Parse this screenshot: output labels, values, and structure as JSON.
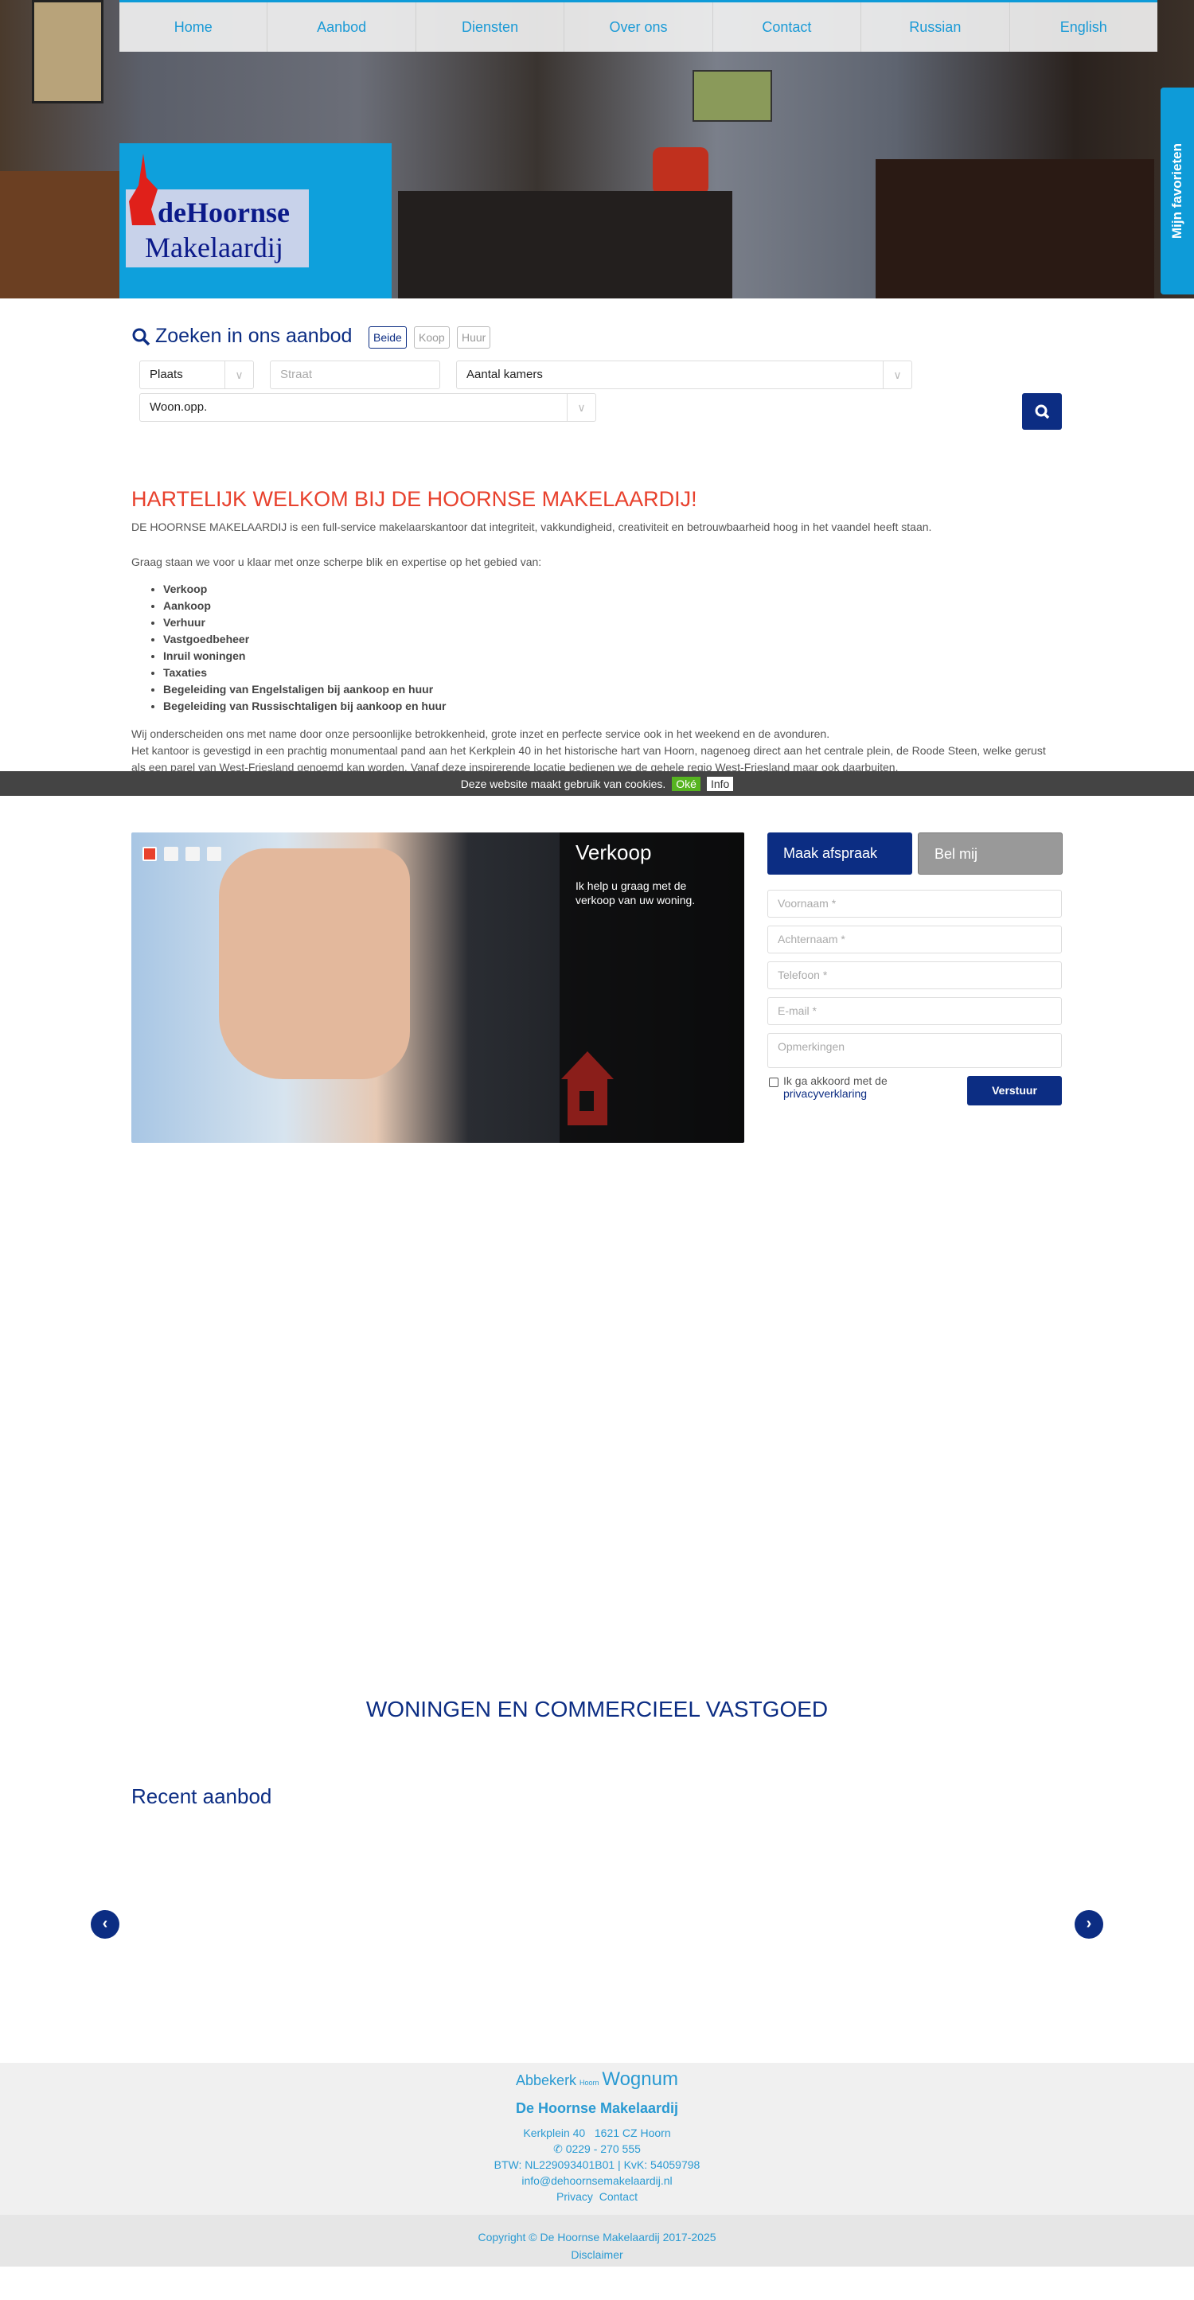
{
  "nav": {
    "items": [
      "Home",
      "Aanbod",
      "Diensten",
      "Over ons",
      "Contact",
      "Russian",
      "English"
    ]
  },
  "logo": {
    "text_top": "deHoornse",
    "text_bottom": "Makelaardij"
  },
  "favorites_tab": "Mijn favorieten",
  "search": {
    "title": "Zoeken in ons aanbod",
    "toggles": [
      "Beide",
      "Koop",
      "Huur"
    ],
    "active_toggle": "Beide",
    "plaats": "Plaats",
    "straat_placeholder": "Straat",
    "kamers": "Aantal kamers",
    "woonopp": "Woon.opp."
  },
  "welcome": {
    "title": "HARTELIJK WELKOM BIJ DE HOORNSE MAKELAARDIJ!",
    "intro": "DE HOORNSE MAKELAARDIJ is een full-service makelaarskantoor dat integriteit, vakkundigheid, creativiteit en betrouwbaarheid hoog in het vaandel heeft staan.",
    "lead": "Graag staan we voor u klaar met onze scherpe blik en expertise op het gebied van:",
    "services": [
      "Verkoop",
      "Aankoop",
      "Verhuur",
      "Vastgoedbeheer",
      "Inruil woningen",
      "Taxaties",
      "Begeleiding van Engelstaligen bij aankoop en huur",
      "Begeleiding van Russischtaligen bij aankoop en huur"
    ],
    "p1": "Wij onderscheiden ons met name door onze persoonlijke betrokkenheid, grote inzet en perfecte service ook in het weekend en de avonduren.",
    "p2": "Het kantoor is gevestigd in een prachtig monumentaal pand aan het Kerkplein 40 in het historische hart van Hoorn, nagenoeg direct aan het centrale plein, de Roode Steen, welke gerust als een parel van West-Friesland genoemd kan worden. Vanaf deze inspirerende locatie bedienen we de gehele regio West-Friesland maar ook daarbuiten."
  },
  "cookie": {
    "text": "Deze website maakt gebruik van cookies.",
    "ok": "Oké",
    "info": "Info"
  },
  "slider": {
    "title": "Verkoop",
    "text": "Ik help u graag met de verkoop van uw woning.",
    "slides": 4,
    "active_slide": 1
  },
  "form": {
    "tab_active": "Maak afspraak",
    "tab_inactive": "Bel mij",
    "voornaam": "Voornaam *",
    "achternaam": "Achternaam *",
    "telefoon": "Telefoon *",
    "email": "E-mail *",
    "opmerkingen": "Opmerkingen",
    "agree": "Ik ga akkoord met de",
    "privacy_link": "privacyverklaring",
    "submit": "Verstuur"
  },
  "sections": {
    "woningen": "WONINGEN EN COMMERCIEEL VASTGOED",
    "recent": "Recent aanbod"
  },
  "footer": {
    "tags": [
      "Abbekerk",
      "Hoorn",
      "Wognum"
    ],
    "company": "De Hoornse Makelaardij",
    "address": "Kerkplein 40   1621 CZ Hoorn",
    "phone": "0229 - 270 555",
    "btw": "BTW: NL229093401B01 | KvK: 54059798",
    "email": "info@dehoornsemakelaardij.nl",
    "privacy": "Privacy",
    "contact": "Contact",
    "copyright": "Copyright © De Hoornse Makelaardij 2017-2025",
    "disclaimer": "Disclaimer"
  },
  "colors": {
    "brand_blue": "#0c2d83",
    "accent_cyan": "#0e9bd8",
    "welcome_red": "#e8412d",
    "cookie_ok": "#56b420"
  }
}
